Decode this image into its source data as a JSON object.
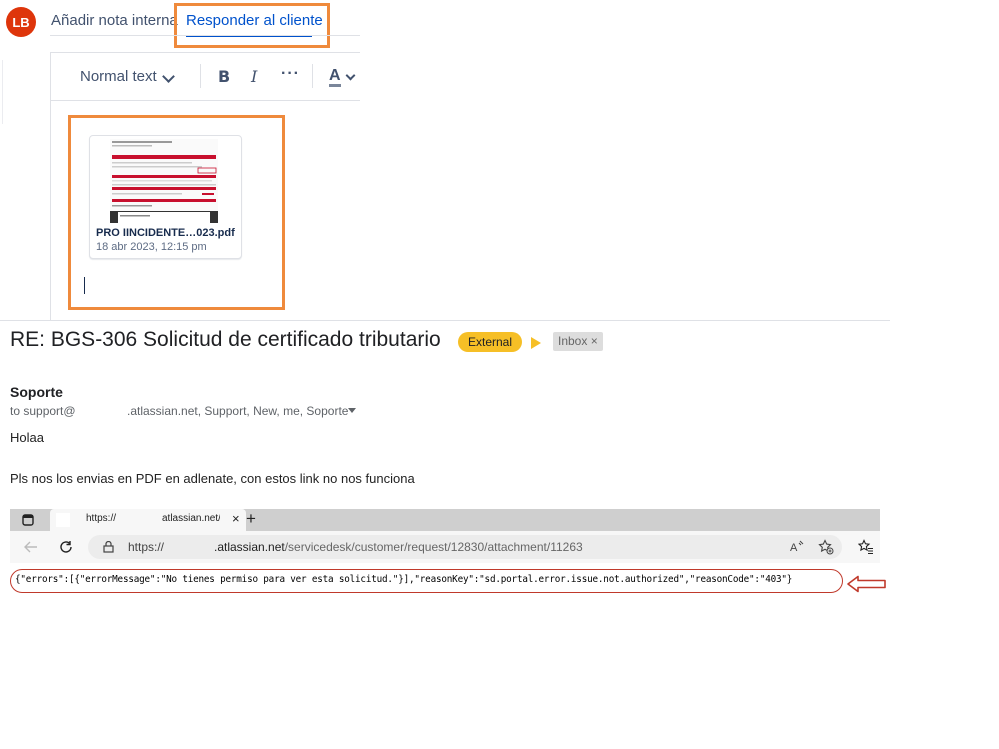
{
  "editor": {
    "avatar_initials": "LB",
    "tabs": [
      {
        "label": "Añadir nota interna",
        "active": false
      },
      {
        "label": "Responder al cliente",
        "active": true
      }
    ],
    "toolbar": {
      "text_style": "Normal text",
      "bold": "B",
      "italic": "I",
      "more": "···",
      "text_color": "A"
    },
    "attachment": {
      "file_name": "PRO IINCIDENTE…023.pdf",
      "date": "18 abr 2023, 12:15 pm"
    }
  },
  "email": {
    "subject": "RE: BGS-306 Solicitud de certificado tributario",
    "label_external": "External",
    "label_inbox": "Inbox",
    "inbox_close": "×",
    "sender": "Soporte",
    "to_prefix": "to support@",
    "to_rest": ".atlassian.net, Support, New, me, Soporte",
    "greeting": "Holaa",
    "message": "Pls nos los envias en PDF en adlenate, con estos link no nos funciona"
  },
  "browser": {
    "tab_prefix": "https://",
    "tab_suffix": "atlassian.net/s(",
    "tab_close": "×",
    "new_tab": "+",
    "url_prefix": "https://",
    "url_host": ".atlassian.net",
    "url_path": "/servicedesk/customer/request/12830/attachment/11263",
    "response": "{\"errors\":[{\"errorMessage\":\"No tienes permiso para ver esta solicitud.\"}],\"reasonKey\":\"sd.portal.error.issue.not.authorized\",\"reasonCode\":\"403\"}"
  },
  "colors": {
    "highlight_box": "#ef8a3c",
    "avatar": "#de350b",
    "link_blue": "#0052cc",
    "external_badge": "#f6bf26",
    "annotation_red": "#c0392b"
  }
}
